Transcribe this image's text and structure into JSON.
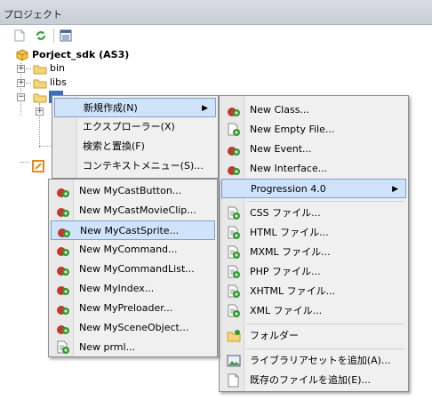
{
  "panel": {
    "title": "プロジェクト"
  },
  "tree": {
    "root": "Porject_sdk (AS3)",
    "items": [
      "bin",
      "libs"
    ]
  },
  "context_menu": {
    "items": [
      "新規作成(N)",
      "エクスプローラー(X)",
      "検索と置換(F)",
      "コンテキストメニュー(S)..."
    ]
  },
  "new_submenu": {
    "items": [
      "New Class...",
      "New Empty File...",
      "New Event...",
      "New Interface...",
      "Progression 4.0",
      "CSS ファイル...",
      "HTML ファイル...",
      "MXML ファイル...",
      "PHP ファイル...",
      "XHTML ファイル...",
      "XML ファイル...",
      "フォルダー",
      "ライブラリアセットを追加(A)...",
      "既存のファイルを追加(E)..."
    ]
  },
  "progression_submenu": {
    "items": [
      "New MyCastButton...",
      "New MyCastMovieClip...",
      "New MyCastSprite...",
      "New MyCommand...",
      "New MyCommandList...",
      "New MyIndex...",
      "New MyPreloader...",
      "New MySceneObject...",
      "New prml..."
    ]
  },
  "colors": {
    "highlight": "#cfe3fb",
    "highlight_border": "#7da2ce",
    "menu_bg": "#f0f0f0"
  }
}
